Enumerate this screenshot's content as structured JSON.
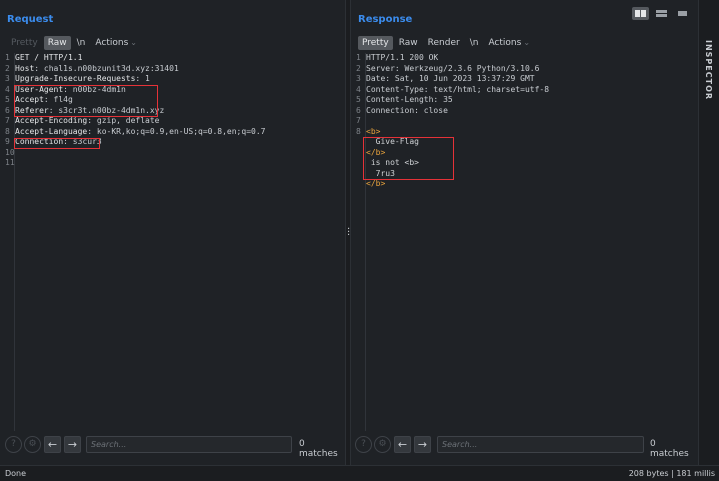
{
  "request": {
    "title": "Request",
    "tabs": [
      {
        "label": "Pretty",
        "state": "disabled"
      },
      {
        "label": "Raw",
        "state": "active"
      },
      {
        "label": "\\n",
        "state": "normal"
      },
      {
        "label": "Actions",
        "state": "normal"
      }
    ],
    "lines": [
      {
        "num": "1",
        "key": "GET / HTTP/1.1",
        "val": ""
      },
      {
        "num": "2",
        "key": "Host",
        "val": ": chal1s.n00bzunit3d.xyz:31401"
      },
      {
        "num": "3",
        "key": "Upgrade-Insecure-Requests",
        "val": ": 1"
      },
      {
        "num": "4",
        "key": "User-Agent",
        "val": ": n00bz-4dm1n"
      },
      {
        "num": "5",
        "key": "Accept",
        "val": ": fl4g"
      },
      {
        "num": "6",
        "key": "Referer",
        "val": ": s3cr3t.n00bz-4dm1n.xyz"
      },
      {
        "num": "7",
        "key": "Accept-Encoding",
        "val": ": gzip, deflate"
      },
      {
        "num": "8",
        "key": "Accept-Language",
        "val": ": ko-KR,ko;q=0.9,en-US;q=0.8,en;q=0.7"
      },
      {
        "num": "9",
        "key": "Connection",
        "val": ": s3cur3"
      },
      {
        "num": "10",
        "key": "",
        "val": ""
      },
      {
        "num": "11",
        "key": "",
        "val": ""
      }
    ],
    "search": {
      "placeholder": "Search...",
      "matches": "0 matches"
    }
  },
  "response": {
    "title": "Response",
    "tabs": [
      {
        "label": "Pretty",
        "state": "active"
      },
      {
        "label": "Raw",
        "state": "normal"
      },
      {
        "label": "Render",
        "state": "normal"
      },
      {
        "label": "\\n",
        "state": "normal"
      },
      {
        "label": "Actions",
        "state": "normal"
      }
    ],
    "lines": [
      {
        "num": "1",
        "text": "HTTP/1.1 200 OK"
      },
      {
        "num": "2",
        "text": "Server: Werkzeug/2.3.6 Python/3.10.6"
      },
      {
        "num": "3",
        "text": "Date: Sat, 10 Jun 2023 13:37:29 GMT"
      },
      {
        "num": "4",
        "text": "Content-Type: text/html; charset=utf-8"
      },
      {
        "num": "5",
        "text": "Content-Length: 35"
      },
      {
        "num": "6",
        "text": "Connection: close"
      },
      {
        "num": "7",
        "text": ""
      },
      {
        "num": "8",
        "text": "<b>"
      },
      {
        "num": "",
        "text": "  Give-Flag"
      },
      {
        "num": "",
        "text": "</b>"
      },
      {
        "num": "",
        "text": " is not <b>"
      },
      {
        "num": "",
        "text": "  7ru3"
      },
      {
        "num": "",
        "text": "</b>"
      }
    ],
    "search": {
      "placeholder": "Search...",
      "matches": "0 matches"
    }
  },
  "inspector_label": "INSPECTOR",
  "status": {
    "left": "Done",
    "right": "208 bytes | 181 millis"
  },
  "colors": {
    "accent": "#3b8ced",
    "highlight": "#e53238",
    "tag": "#e8a33d"
  }
}
